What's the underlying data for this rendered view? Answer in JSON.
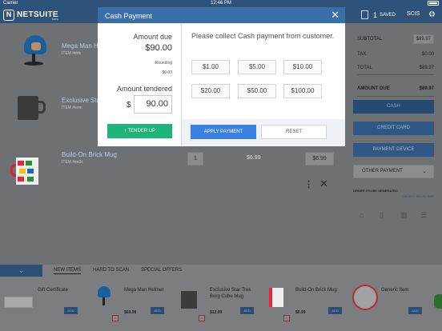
{
  "status_bar": {
    "carrier": "Carrier",
    "time": "12:46 PM"
  },
  "app": {
    "logo_text": "NETSUITE",
    "logo_sub": "SCIS",
    "saved_count": "1",
    "saved_label": "SAVED",
    "store_label": "SCIS",
    "settings_icon": "gear-icon"
  },
  "cart": {
    "items": [
      {
        "name": "Mega Man H",
        "sku": "ITEM #thtk"
      },
      {
        "name": "Exclusive Star",
        "sku": "ITEM #ienn"
      },
      {
        "name": "Build-On Brick Mug",
        "sku": "ITEM #ee3c",
        "qty": "1",
        "unit_price": "$6.99",
        "total": "$6.99"
      }
    ]
  },
  "summary": {
    "subtotal_label": "SUBTOTAL",
    "subtotal": "$89.97",
    "tax_label": "TAX",
    "tax": "$0.00",
    "total_label": "TOTAL",
    "total": "$89.97",
    "amount_due_label": "AMOUNT DUE",
    "amount_due": "$89.97"
  },
  "payment_buttons": {
    "cash": "CASH",
    "credit_card": "CREDIT CARD",
    "payment_device": "PAYMENT DEVICE",
    "other_payment": "OTHER PAYMENT"
  },
  "order_id": "ORDER #TO BE GENERATED",
  "sales_rep": "SELECT SALES REP",
  "shelf": {
    "tabs": [
      "NEW ITEMS",
      "HARD TO SCAN",
      "SPECIAL OFFERS"
    ],
    "products": [
      {
        "name": "Gift Certificate",
        "price": "",
        "add": "ADD"
      },
      {
        "name": "Mega Man Helmet",
        "price": "$69.99",
        "add": "ADD"
      },
      {
        "name": "Exclusive Star Trek",
        "name2": "Borg Cube Mug",
        "price": "$12.99",
        "add": "ADD"
      },
      {
        "name": "Build-On Brick Mug",
        "price": "$6.99",
        "add": "ADD"
      },
      {
        "name": "Generic Item",
        "price": "",
        "add": "ADD"
      }
    ]
  },
  "modal": {
    "title": "Cash Payment",
    "amount_due_label": "Amount due",
    "amount_due": "$90.00",
    "rounding_label": "Rounding",
    "rounding": "$0.03",
    "amount_tendered_label": "Amount tendered",
    "currency": "$",
    "amount_tendered": "90.00",
    "tender_up": "TENDER UP",
    "message": "Please collect Cash payment from customer.",
    "quick_amounts": [
      "$1.00",
      "$5.00",
      "$10.00",
      "$20.00",
      "$50.00",
      "$100.00"
    ],
    "apply": "APPLY PAYMENT",
    "reset": "RESET"
  }
}
